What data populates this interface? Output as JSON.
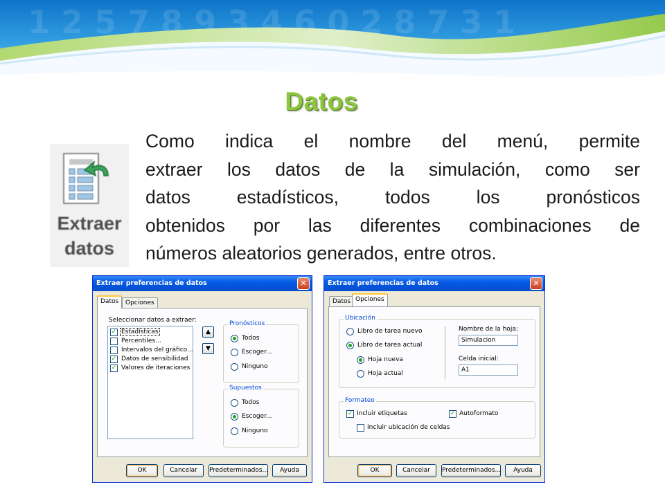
{
  "slide": {
    "title": "Datos",
    "icon": {
      "name": "extraer-datos-icon",
      "label_line1": "Extraer",
      "label_line2": "datos"
    },
    "paragraph_lines": [
      "Como indica el nombre del menú, permite",
      "extraer los datos de la simulación, como ser",
      "datos estadísticos, todos los pronósticos",
      "obtenidos por las diferentes combinaciones de",
      "números aleatorios generados, entre otros."
    ],
    "colors": {
      "title": "#8cc63f",
      "banner_blue": "#1d8fd8",
      "banner_green": "#8cc63f",
      "xp_titlebar": "#0353d9"
    }
  },
  "dialog_datos": {
    "title": "Extraer preferencias de datos",
    "tabs": [
      {
        "label": "Datos",
        "active": true
      },
      {
        "label": "Opciones",
        "active": false
      }
    ],
    "select_label": "Seleccionar datos a extraer:",
    "list_items": [
      {
        "label": "Estadísticas",
        "checked": true
      },
      {
        "label": "Percentiles...",
        "checked": false
      },
      {
        "label": "Intervalos del gráfico...",
        "checked": false
      },
      {
        "label": "Datos de sensibilidad",
        "checked": true
      },
      {
        "label": "Valores de iteraciones",
        "checked": true
      }
    ],
    "pronosticos": {
      "legend": "Pronósticos",
      "options": [
        {
          "label": "Todos",
          "selected": true
        },
        {
          "label": "Escoger...",
          "selected": false
        },
        {
          "label": "Ninguno",
          "selected": false
        }
      ]
    },
    "supuestos": {
      "legend": "Supuestos",
      "options": [
        {
          "label": "Todos",
          "selected": false
        },
        {
          "label": "Escoger...",
          "selected": true
        },
        {
          "label": "Ninguno",
          "selected": false
        }
      ]
    },
    "buttons": {
      "ok": "OK",
      "cancel": "Cancelar",
      "defaults": "Predeterminados...",
      "help": "Ayuda"
    }
  },
  "dialog_opciones": {
    "title": "Extraer preferencias de datos",
    "tabs": [
      {
        "label": "Datos",
        "active": false
      },
      {
        "label": "Opciones",
        "active": true
      }
    ],
    "ubicacion": {
      "legend": "Ubicación",
      "libro_nuevo": "Libro de tarea nuevo",
      "libro_actual": "Libro de tarea actual",
      "hoja_nueva": "Hoja nueva",
      "hoja_actual": "Hoja actual",
      "selected_libro": "Libro de tarea actual",
      "selected_hoja": "Hoja nueva",
      "sheet_name_label": "Nombre de la hoja:",
      "sheet_name_value": "Simulacion",
      "start_cell_label": "Celda inicial:",
      "start_cell_value": "A1"
    },
    "formateo": {
      "legend": "Formateo",
      "incluir_etiquetas": {
        "label": "Incluir etiquetas",
        "checked": true
      },
      "autoformato": {
        "label": "Autoformato",
        "checked": true
      },
      "incluir_ubicacion": {
        "label": "Incluir ubicación de celdas",
        "checked": false
      }
    },
    "buttons": {
      "ok": "OK",
      "cancel": "Cancelar",
      "defaults": "Predeterminados...",
      "help": "Ayuda"
    }
  }
}
